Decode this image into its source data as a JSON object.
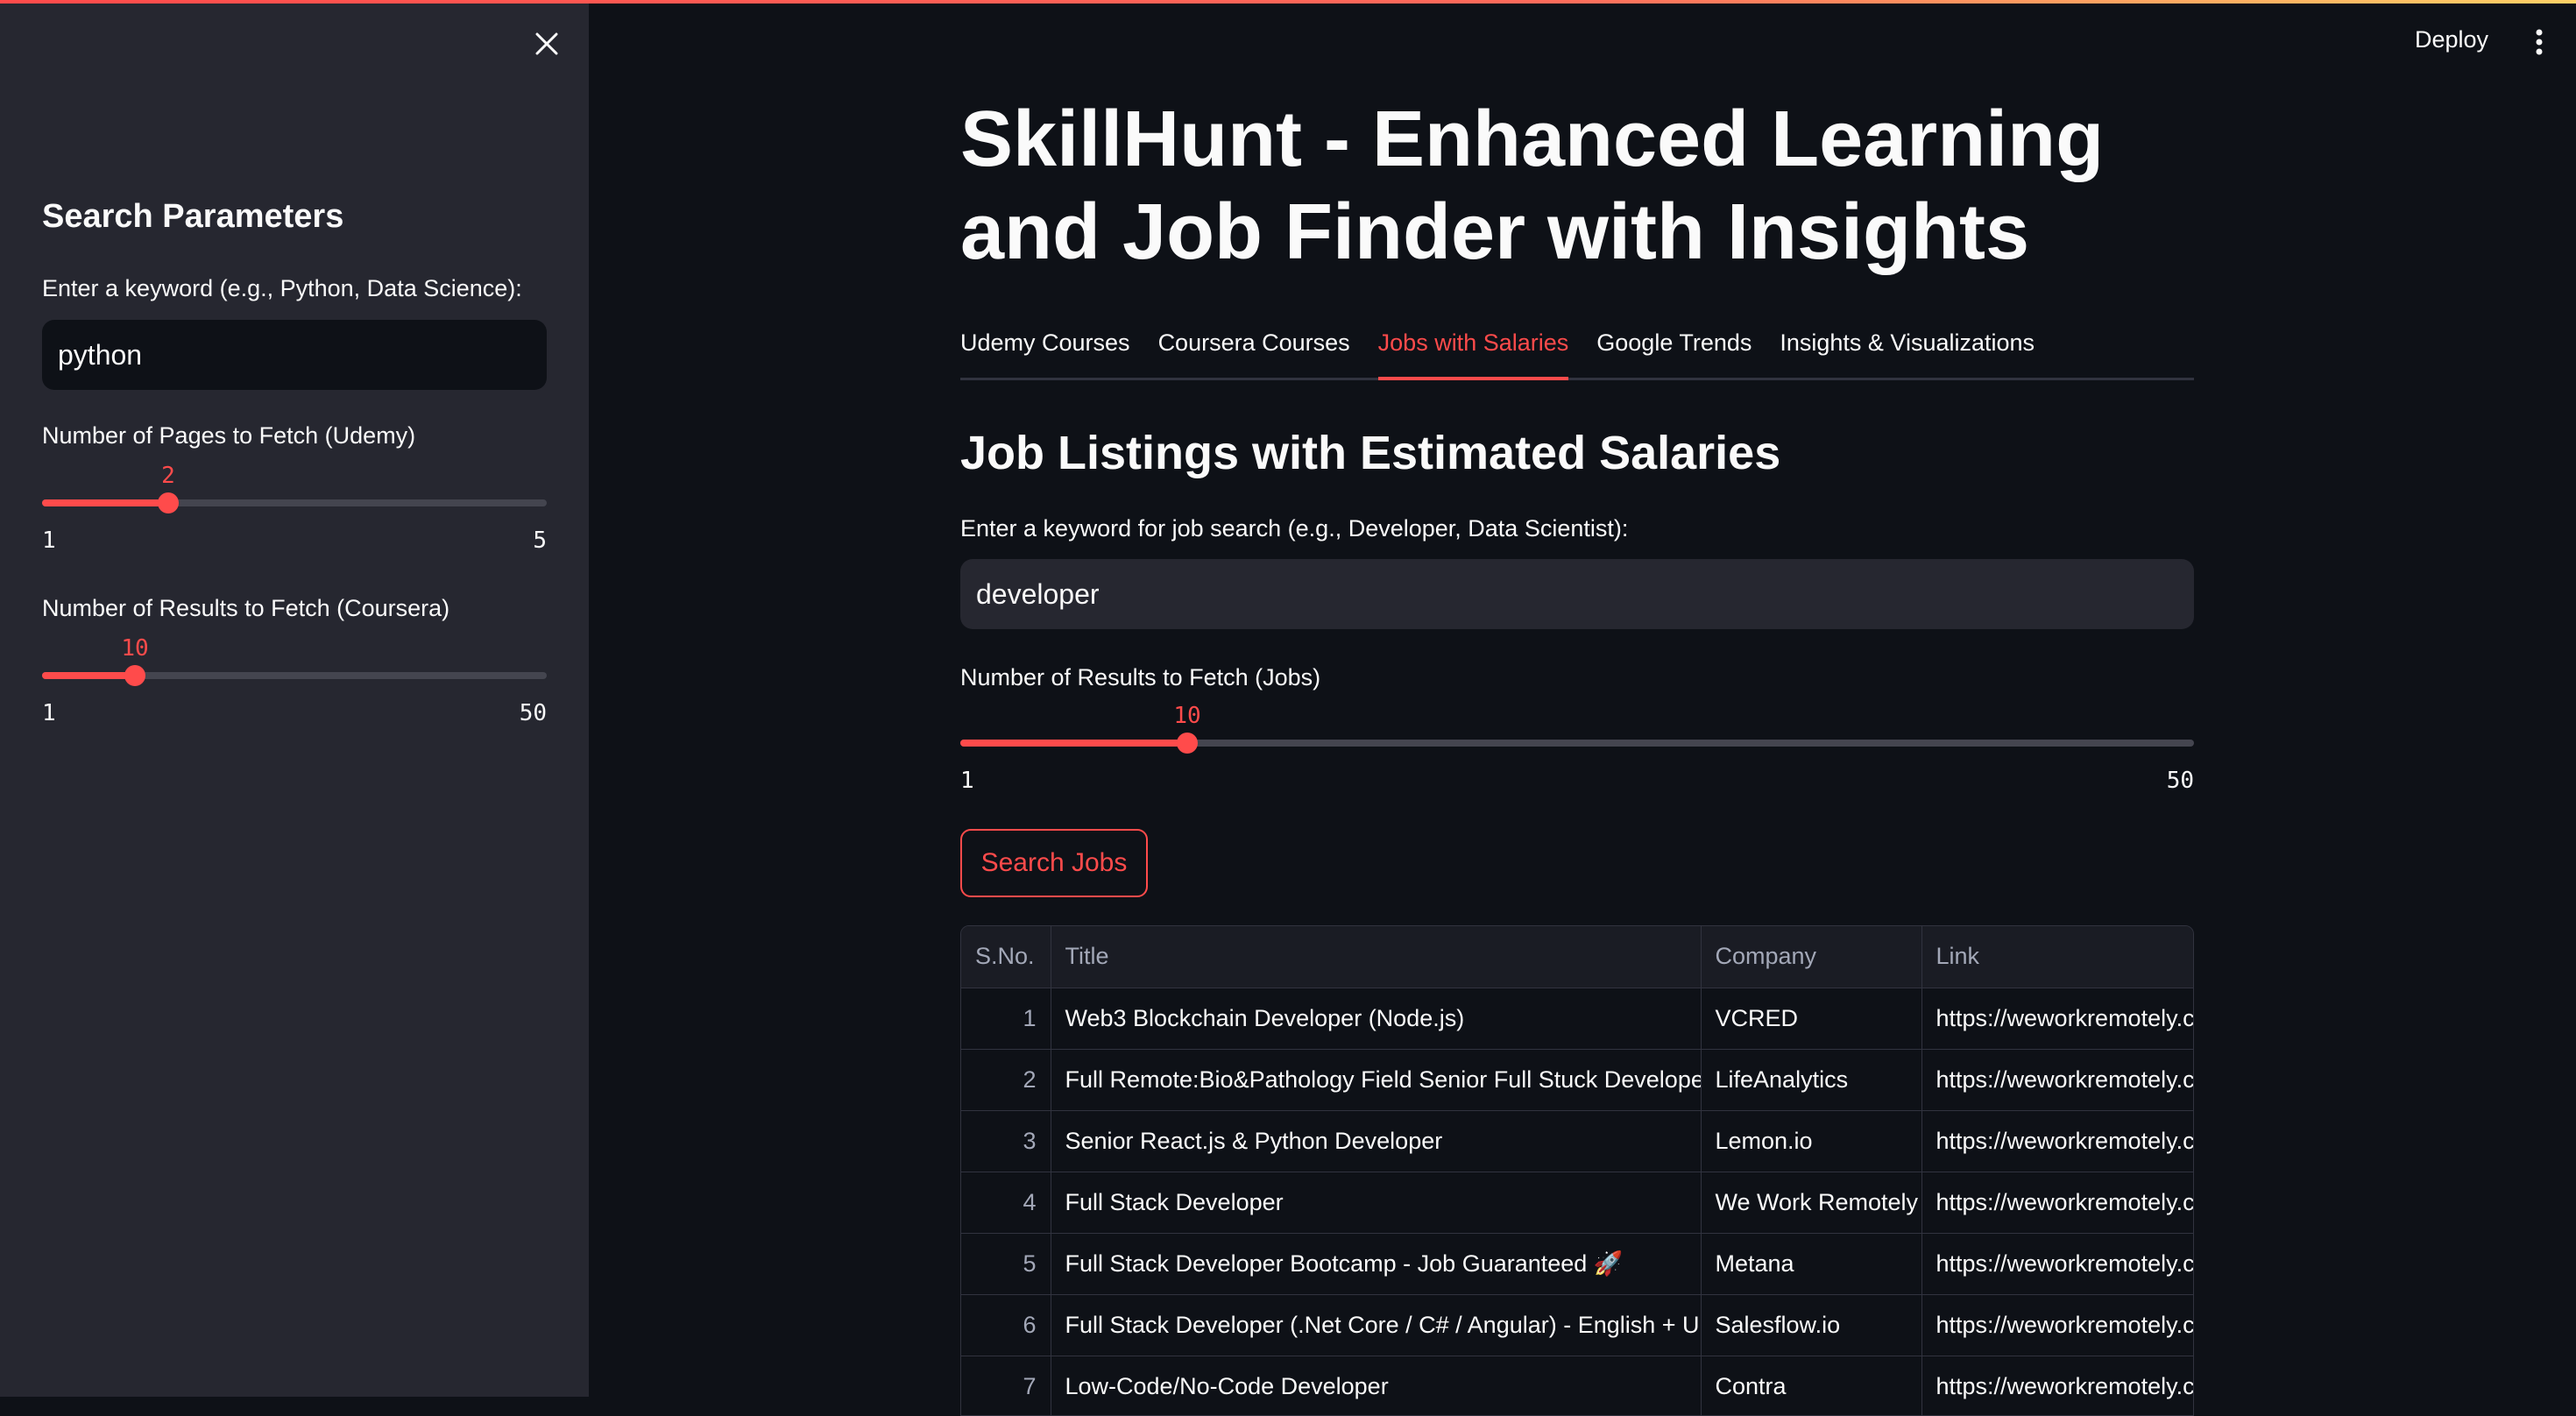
{
  "sidebar": {
    "title": "Search Parameters",
    "keyword_label": "Enter a keyword (e.g., Python, Data Science):",
    "keyword_value": "python",
    "udemy_pages": {
      "label": "Number of Pages to Fetch (Udemy)",
      "value": "2",
      "min": "1",
      "max": "5",
      "fraction": 0.25
    },
    "coursera_results": {
      "label": "Number of Results to Fetch (Coursera)",
      "value": "10",
      "min": "1",
      "max": "50",
      "fraction": 0.184
    }
  },
  "header": {
    "deploy_label": "Deploy"
  },
  "main": {
    "title": "SkillHunt - Enhanced Learning and Job Finder with Insights",
    "tabs": [
      {
        "label": "Udemy Courses"
      },
      {
        "label": "Coursera Courses"
      },
      {
        "label": "Jobs with Salaries"
      },
      {
        "label": "Google Trends"
      },
      {
        "label": "Insights & Visualizations"
      }
    ],
    "active_tab": "Jobs with Salaries",
    "section_title": "Job Listings with Estimated Salaries",
    "job_keyword_label": "Enter a keyword for job search (e.g., Developer, Data Scientist):",
    "job_keyword_value": "developer",
    "jobs_slider": {
      "label": "Number of Results to Fetch (Jobs)",
      "value": "10",
      "min": "1",
      "max": "50",
      "fraction": 0.184
    },
    "search_button": "Search Jobs",
    "table": {
      "columns": [
        "S.No.",
        "Title",
        "Company",
        "Link"
      ],
      "rows": [
        [
          "1",
          "Web3 Blockchain Developer (Node.js)",
          "VCRED",
          "https://weworkremotely.c"
        ],
        [
          "2",
          "Full Remote:Bio&Pathology Field Senior Full Stuck Developer",
          "LifeAnalytics",
          "https://weworkremotely.c"
        ],
        [
          "3",
          "Senior React.js & Python Developer",
          "Lemon.io",
          "https://weworkremotely.c"
        ],
        [
          "4",
          "Full Stack Developer",
          "We Work Remotely",
          "https://weworkremotely.c"
        ],
        [
          "5",
          "Full Stack Developer Bootcamp - Job Guaranteed 🚀",
          "Metana",
          "https://weworkremotely.c"
        ],
        [
          "6",
          "Full Stack Developer (.Net Core / C# / Angular) - English + Ukrai",
          "Salesflow.io",
          "https://weworkremotely.c"
        ],
        [
          "7",
          "Low-Code/No-Code Developer",
          "Contra",
          "https://weworkremotely.c"
        ]
      ]
    }
  },
  "colors": {
    "accent": "#ff4b4b",
    "sidebar_bg": "#262730",
    "main_bg": "#0e1117"
  }
}
